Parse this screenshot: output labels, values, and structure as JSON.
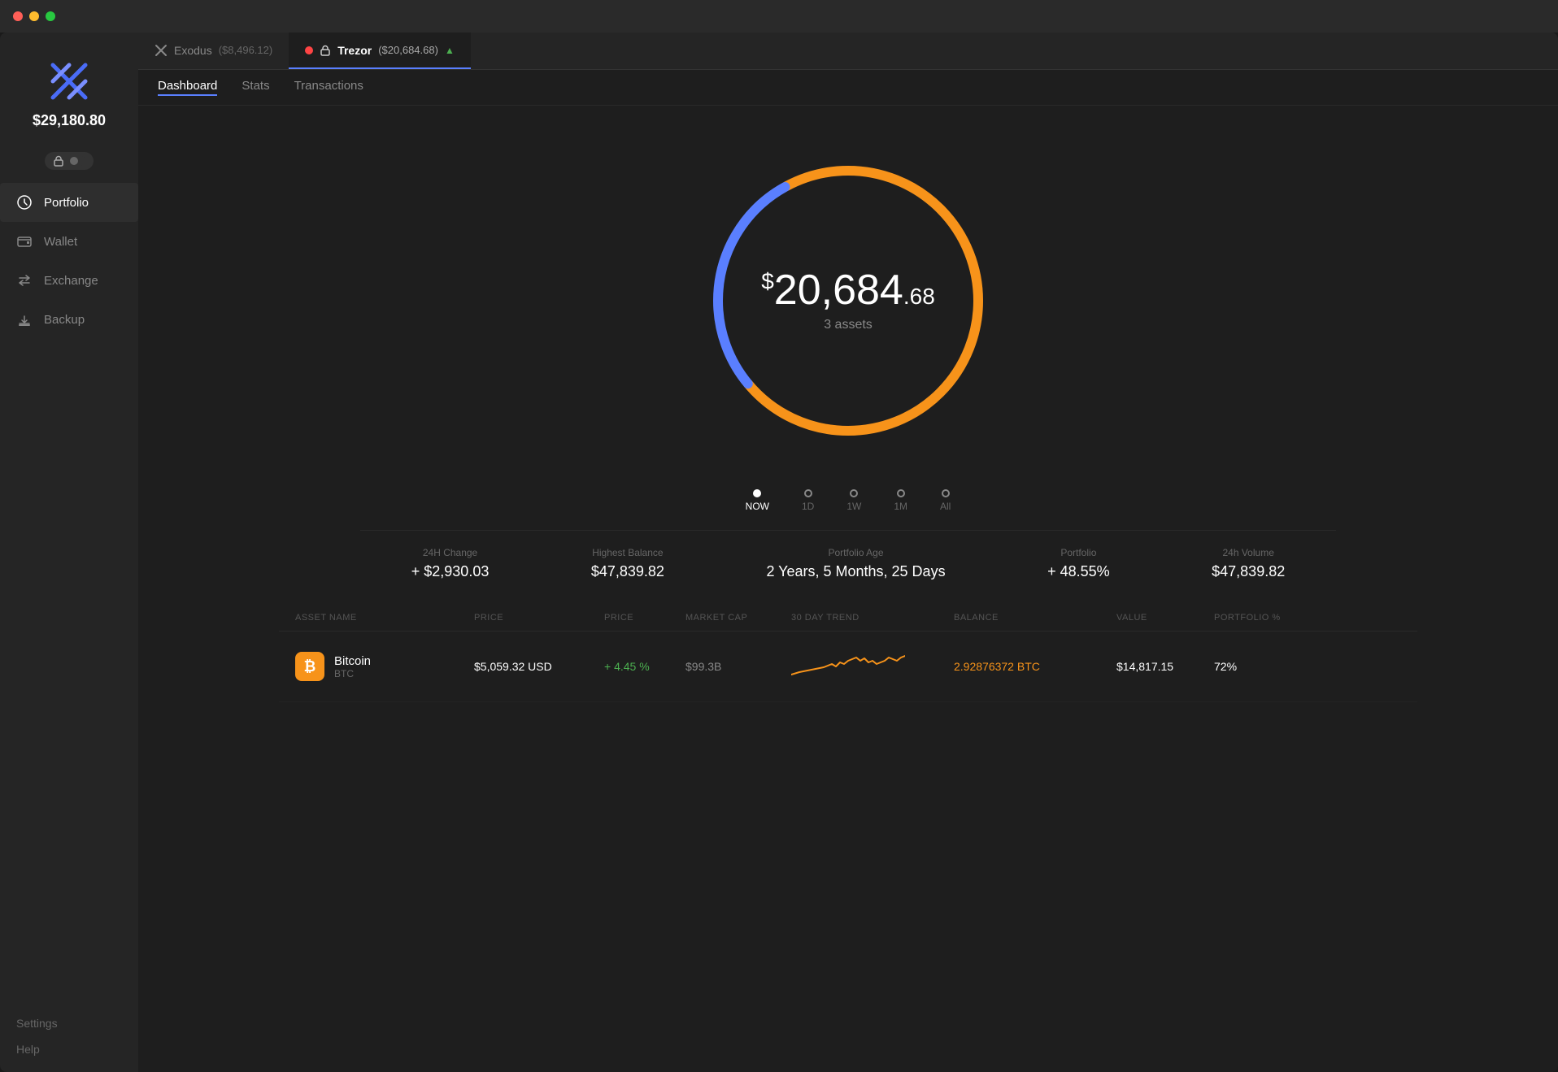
{
  "titlebar": {
    "traffic": [
      "red",
      "yellow",
      "green"
    ]
  },
  "sidebar": {
    "logo_alt": "App Logo",
    "total_balance": "$29,180.80",
    "nav_items": [
      {
        "id": "portfolio",
        "label": "Portfolio",
        "active": true
      },
      {
        "id": "wallet",
        "label": "Wallet",
        "active": false
      },
      {
        "id": "exchange",
        "label": "Exchange",
        "active": false
      },
      {
        "id": "backup",
        "label": "Backup",
        "active": false
      }
    ],
    "bottom_items": [
      {
        "id": "settings",
        "label": "Settings"
      },
      {
        "id": "help",
        "label": "Help"
      }
    ]
  },
  "wallet_tabs": [
    {
      "id": "exodus",
      "icon": "X",
      "name": "Exodus",
      "amount": "($8,496.12)",
      "active": false
    },
    {
      "id": "trezor",
      "icon": "lock",
      "name": "Trezor",
      "amount": "($20,684.68)",
      "active": true
    }
  ],
  "sub_tabs": [
    "Dashboard",
    "Stats",
    "Transactions"
  ],
  "active_sub_tab": "Dashboard",
  "chart": {
    "amount_prefix": "$",
    "amount_main": "20,684",
    "amount_cents": ".68",
    "assets_label": "3 assets",
    "blue_pct": 28,
    "yellow_pct": 72,
    "colors": {
      "blue": "#5a7fff",
      "yellow": "#f7931a",
      "bg": "#1e1e1e"
    }
  },
  "timeline": [
    {
      "id": "now",
      "label": "NOW",
      "active": true
    },
    {
      "id": "1d",
      "label": "1D",
      "active": false
    },
    {
      "id": "1w",
      "label": "1W",
      "active": false
    },
    {
      "id": "1m",
      "label": "1M",
      "active": false
    },
    {
      "id": "all",
      "label": "All",
      "active": false
    }
  ],
  "stats": [
    {
      "id": "change_24h",
      "label": "24H Change",
      "value": "+ $2,930.03"
    },
    {
      "id": "highest_balance",
      "label": "Highest Balance",
      "value": "$47,839.82"
    },
    {
      "id": "portfolio_age",
      "label": "Portfolio Age",
      "value": "2 Years, 5 Months, 25 Days"
    },
    {
      "id": "portfolio",
      "label": "Portfolio",
      "value": "+ 48.55%"
    },
    {
      "id": "volume_24h",
      "label": "24h Volume",
      "value": "$47,839.82"
    }
  ],
  "table": {
    "headers": [
      "ASSET NAME",
      "PRICE",
      "PRICE",
      "MARKET CAP",
      "30 DAY TREND",
      "BALANCE",
      "VALUE",
      "PORTFOLIO %"
    ],
    "rows": [
      {
        "id": "btc",
        "icon": "₿",
        "icon_color": "#f7931a",
        "name": "Bitcoin",
        "symbol": "BTC",
        "price_usd": "$5,059.32 USD",
        "price_change": "+ 4.45 %",
        "market_cap": "$99.3B",
        "balance": "2.92876372 BTC",
        "value": "$14,817.15",
        "portfolio_pct": "72%"
      }
    ]
  }
}
